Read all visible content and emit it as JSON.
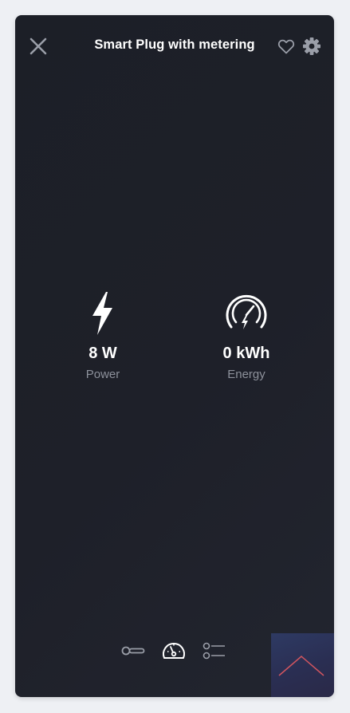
{
  "header": {
    "title": "Smart Plug with metering",
    "close_icon": "close-icon",
    "favorite_icon": "heart-outline-icon",
    "settings_icon": "gear-icon"
  },
  "metrics": [
    {
      "icon": "lightning-bolt-icon",
      "value": "8 W",
      "label": "Power"
    },
    {
      "icon": "energy-meter-icon",
      "value": "0 kWh",
      "label": "Energy"
    }
  ],
  "bottom_nav": {
    "items": [
      {
        "icon": "toggle-slider-icon",
        "active": false
      },
      {
        "icon": "speedometer-icon",
        "active": true
      },
      {
        "icon": "list-icon",
        "active": false
      }
    ]
  },
  "scroll_top": {
    "icon": "chevron-up-icon"
  },
  "colors": {
    "card_background": "#1e2029",
    "text_primary": "#ffffff",
    "text_secondary": "#8d919b",
    "icon_muted": "#9a9ea8",
    "scroll_top_bg": "#2c3358",
    "scroll_top_chevron": "#d1555f"
  }
}
